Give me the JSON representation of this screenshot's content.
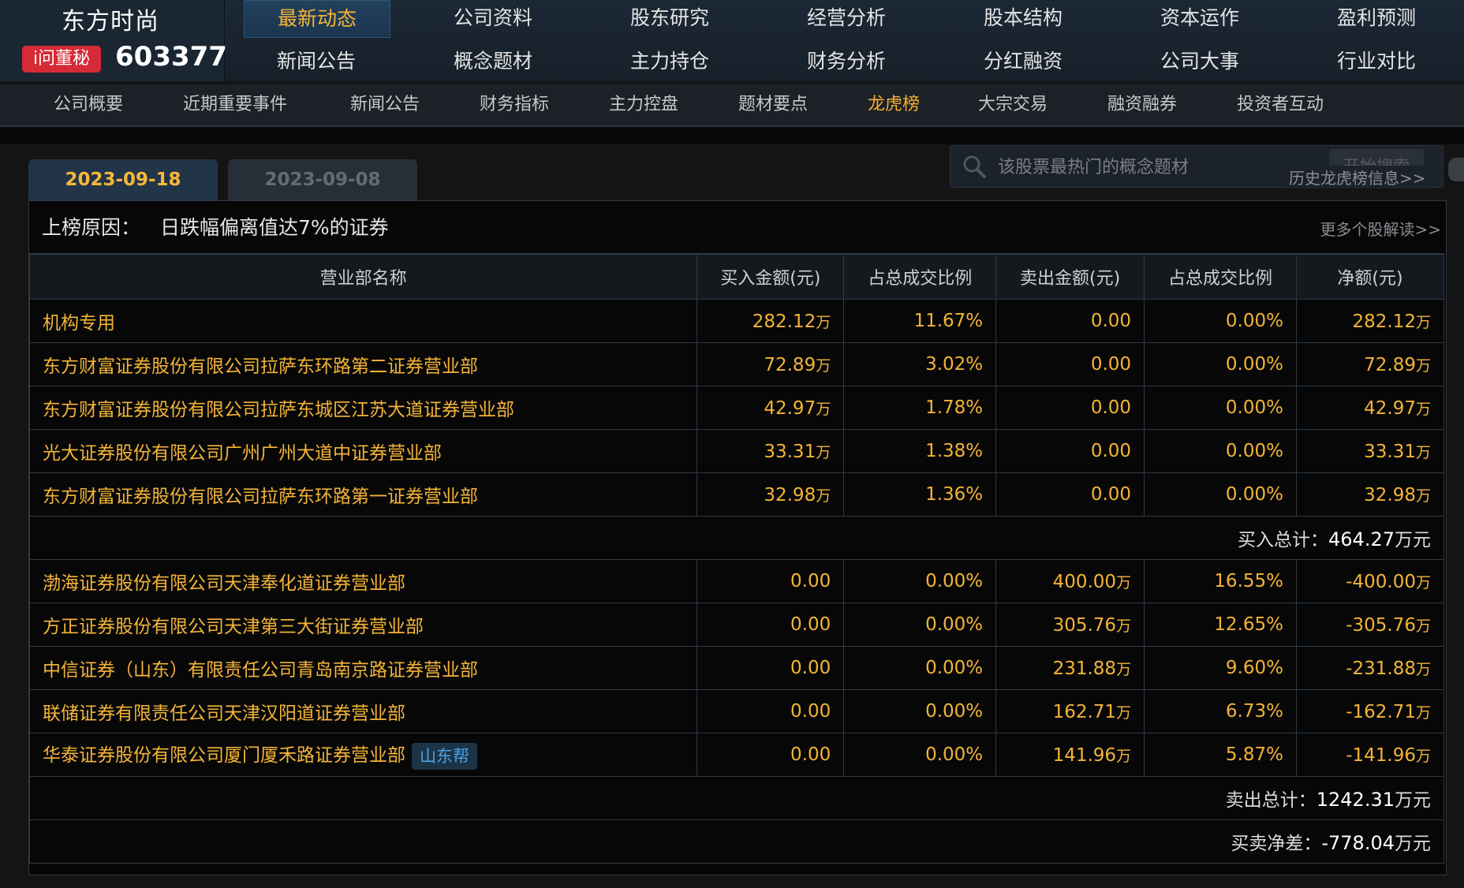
{
  "header": {
    "stock_name": "东方时尚",
    "ask_button": "i问董秘",
    "stock_code": "603377"
  },
  "main_nav": {
    "row1": [
      "最新动态",
      "公司资料",
      "股东研究",
      "经营分析",
      "股本结构",
      "资本运作",
      "盈利预测"
    ],
    "row2": [
      "新闻公告",
      "概念题材",
      "主力持仓",
      "财务分析",
      "分红融资",
      "公司大事",
      "行业对比"
    ],
    "active": "最新动态"
  },
  "sub_nav": {
    "items": [
      "公司概要",
      "近期重要事件",
      "新闻公告",
      "财务指标",
      "主力控盘",
      "题材要点",
      "龙虎榜",
      "大宗交易",
      "融资融券",
      "投资者互动"
    ],
    "active": "龙虎榜"
  },
  "tabs": [
    "2023-09-18",
    "2023-09-08"
  ],
  "search": {
    "placeholder": "该股票最热门的概念题材",
    "button": "开始搜索",
    "history_link": "历史龙虎榜信息>>"
  },
  "reason": {
    "label": "上榜原因：",
    "text": "日跌幅偏离值达7%的证券",
    "more_link": "更多个股解读>>"
  },
  "table": {
    "columns": [
      "营业部名称",
      "买入金额(元)",
      "占总成交比例",
      "卖出金额(元)",
      "占总成交比例",
      "净额(元)"
    ],
    "buy_rows": [
      {
        "name": "机构专用",
        "buy": "282.12",
        "buy_unit": "万",
        "buy_pct": "11.67%",
        "sell": "0.00",
        "sell_unit": "",
        "sell_pct": "0.00%",
        "net": "282.12",
        "net_unit": "万"
      },
      {
        "name": "东方财富证券股份有限公司拉萨东环路第二证券营业部",
        "buy": "72.89",
        "buy_unit": "万",
        "buy_pct": "3.02%",
        "sell": "0.00",
        "sell_unit": "",
        "sell_pct": "0.00%",
        "net": "72.89",
        "net_unit": "万"
      },
      {
        "name": "东方财富证券股份有限公司拉萨东城区江苏大道证券营业部",
        "buy": "42.97",
        "buy_unit": "万",
        "buy_pct": "1.78%",
        "sell": "0.00",
        "sell_unit": "",
        "sell_pct": "0.00%",
        "net": "42.97",
        "net_unit": "万"
      },
      {
        "name": "光大证券股份有限公司广州广州大道中证券营业部",
        "buy": "33.31",
        "buy_unit": "万",
        "buy_pct": "1.38%",
        "sell": "0.00",
        "sell_unit": "",
        "sell_pct": "0.00%",
        "net": "33.31",
        "net_unit": "万"
      },
      {
        "name": "东方财富证券股份有限公司拉萨东环路第一证券营业部",
        "buy": "32.98",
        "buy_unit": "万",
        "buy_pct": "1.36%",
        "sell": "0.00",
        "sell_unit": "",
        "sell_pct": "0.00%",
        "net": "32.98",
        "net_unit": "万"
      }
    ],
    "buy_total_label": "买入总计：",
    "buy_total_value": "464.27",
    "buy_total_unit": "万元",
    "sell_rows": [
      {
        "name": "渤海证券股份有限公司天津奉化道证券营业部",
        "buy": "0.00",
        "buy_unit": "",
        "buy_pct": "0.00%",
        "sell": "400.00",
        "sell_unit": "万",
        "sell_pct": "16.55%",
        "net": "-400.00",
        "net_unit": "万"
      },
      {
        "name": "方正证券股份有限公司天津第三大街证券营业部",
        "buy": "0.00",
        "buy_unit": "",
        "buy_pct": "0.00%",
        "sell": "305.76",
        "sell_unit": "万",
        "sell_pct": "12.65%",
        "net": "-305.76",
        "net_unit": "万"
      },
      {
        "name": "中信证券（山东）有限责任公司青岛南京路证券营业部",
        "buy": "0.00",
        "buy_unit": "",
        "buy_pct": "0.00%",
        "sell": "231.88",
        "sell_unit": "万",
        "sell_pct": "9.60%",
        "net": "-231.88",
        "net_unit": "万"
      },
      {
        "name": "联储证券有限责任公司天津汉阳道证券营业部",
        "buy": "0.00",
        "buy_unit": "",
        "buy_pct": "0.00%",
        "sell": "162.71",
        "sell_unit": "万",
        "sell_pct": "6.73%",
        "net": "-162.71",
        "net_unit": "万"
      },
      {
        "name": "华泰证券股份有限公司厦门厦禾路证券营业部",
        "tag": "山东帮",
        "buy": "0.00",
        "buy_unit": "",
        "buy_pct": "0.00%",
        "sell": "141.96",
        "sell_unit": "万",
        "sell_pct": "5.87%",
        "net": "-141.96",
        "net_unit": "万"
      }
    ],
    "sell_total_label": "卖出总计：",
    "sell_total_value": "1242.31",
    "sell_total_unit": "万元",
    "net_label": "买卖净差：",
    "net_value": "-778.04",
    "net_unit": "万元"
  },
  "colors": {
    "accent_gold": "#f4b437",
    "tag_blue": "#4ea3e4",
    "ask_red": "#d62a36",
    "border": "#2e3a48"
  }
}
